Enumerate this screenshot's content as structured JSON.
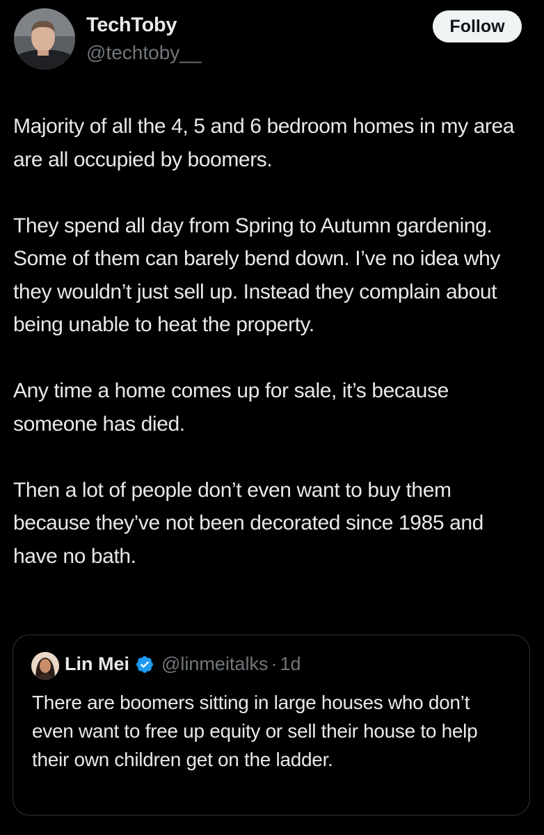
{
  "author": {
    "name": "TechToby",
    "handle": "@techtoby__"
  },
  "follow_button": {
    "label": "Follow"
  },
  "tweet": {
    "paragraphs": [
      "Majority of all the 4, 5 and 6 bedroom homes in my area are all occupied by boomers.",
      "They spend all day from Spring to Autumn gardening. Some of them can barely bend down. I’ve no idea why they wouldn’t just sell up. Instead they complain about being unable to heat the property.",
      "Any time a home comes up for sale, it’s because someone has died.",
      "Then a lot of people don’t even want to buy them because they’ve not been decorated since 1985 and have no bath."
    ]
  },
  "quote": {
    "name": "Lin Mei",
    "verified": true,
    "handle": "@linmeitalks",
    "separator": "·",
    "time": "1d",
    "text": "There are boomers sitting in large houses who don’t even want to free up equity or sell their house to help their own children get on the ladder."
  },
  "colors": {
    "background": "#000000",
    "text_primary": "#e7e9ea",
    "text_secondary": "#71767b",
    "verified_badge": "#1d9bf0",
    "follow_bg": "#eff3f4",
    "card_border": "#2f3336"
  }
}
